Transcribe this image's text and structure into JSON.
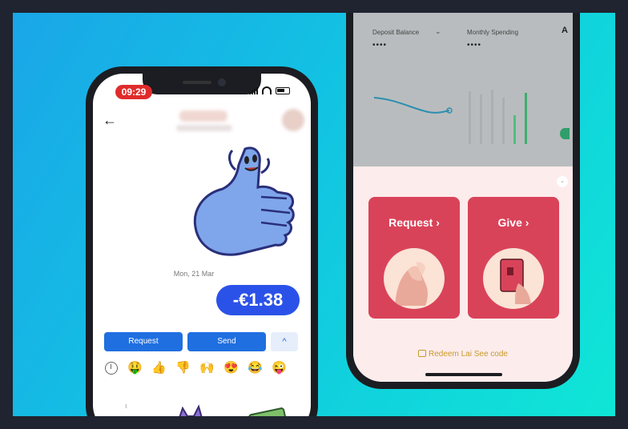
{
  "left_phone": {
    "status": {
      "time": "09:29"
    },
    "date_label": "Mon, 21 Mar",
    "amount": "-€1.38",
    "actions": {
      "request_label": "Request",
      "send_label": "Send",
      "expand_icon": "^"
    },
    "emoji_bar": [
      "clock-icon",
      "🤑",
      "👍",
      "👎",
      "🙌",
      "😍",
      "😂",
      "😜"
    ],
    "sticker_tray": [
      "purple-cat-sticker",
      "money-stack-sticker"
    ]
  },
  "right_phone": {
    "dashboard": {
      "deposit_label": "Deposit Balance",
      "deposit_value": "••••",
      "spending_label": "Monthly Spending",
      "spending_value": "••••",
      "edge_text": "A"
    },
    "sheet": {
      "request_label": "Request",
      "give_label": "Give",
      "chevron": "›",
      "redeem_label": "Redeem Lai See code"
    }
  },
  "colors": {
    "bg_gradient_start": "#1aa6e8",
    "bg_gradient_end": "#0fe6d6",
    "bubble_blue": "#2b52e8",
    "button_blue": "#1f6fe0",
    "card_red": "#d9435a",
    "time_pill": "#e02b2b",
    "redeem_gold": "#c79a2b"
  }
}
